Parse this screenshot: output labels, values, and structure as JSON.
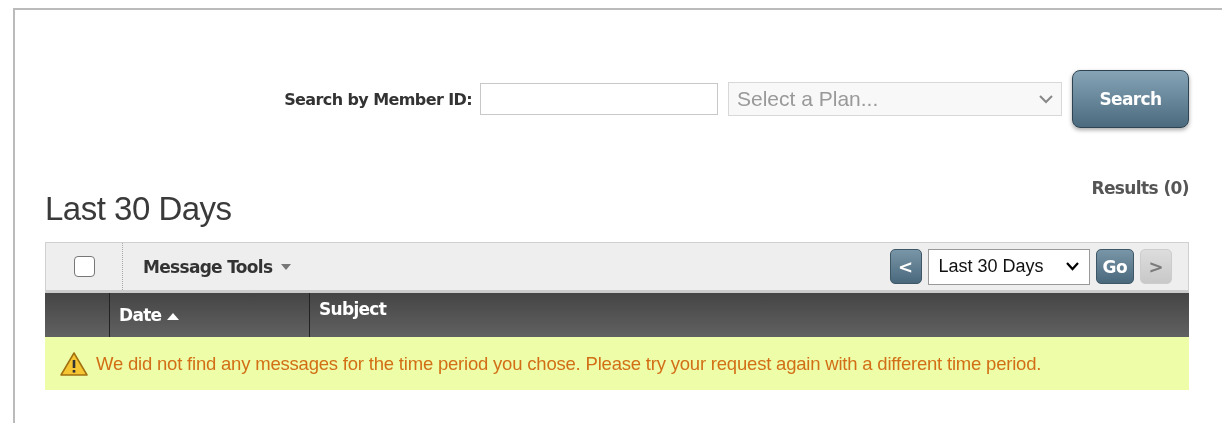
{
  "search": {
    "label": "Search by Member ID:",
    "plan_select": {
      "placeholder": "Select a Plan..."
    },
    "button": "Search"
  },
  "heading": "Last 30 Days",
  "results": "Results (0)",
  "toolbar": {
    "select_all": {
      "checked": false
    },
    "message_tools": "Message Tools",
    "prev": {
      "label": "<",
      "disabled": false
    },
    "period": "Last 30 Days",
    "go": "Go",
    "next": {
      "label": ">",
      "disabled": true
    }
  },
  "table": {
    "columns": [
      {
        "label": "Date",
        "sorted": true
      },
      {
        "label": "Subject",
        "sorted": false
      }
    ]
  },
  "message": "We did not find any messages for the time period you chose. Please try your request again with a different time period."
}
